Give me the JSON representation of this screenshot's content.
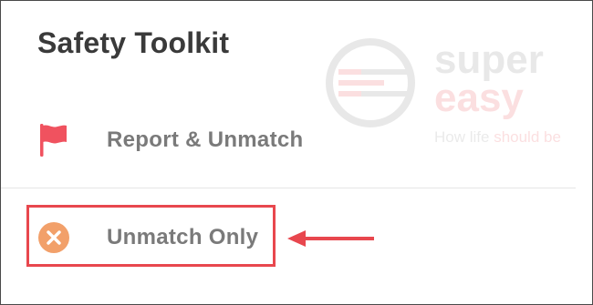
{
  "page": {
    "title": "Safety Toolkit"
  },
  "options": [
    {
      "label": "Report & Unmatch",
      "icon": "flag-icon",
      "icon_color": "#f0525f"
    },
    {
      "label": "Unmatch Only",
      "icon": "close-circle-icon",
      "icon_color": "#f2a06a"
    }
  ],
  "watermark": {
    "brand_top": "super",
    "brand_bottom": "easy",
    "tagline_start": "How life ",
    "tagline_emphasis": "should be"
  },
  "annotation": {
    "highlight_color": "#e8474e"
  }
}
